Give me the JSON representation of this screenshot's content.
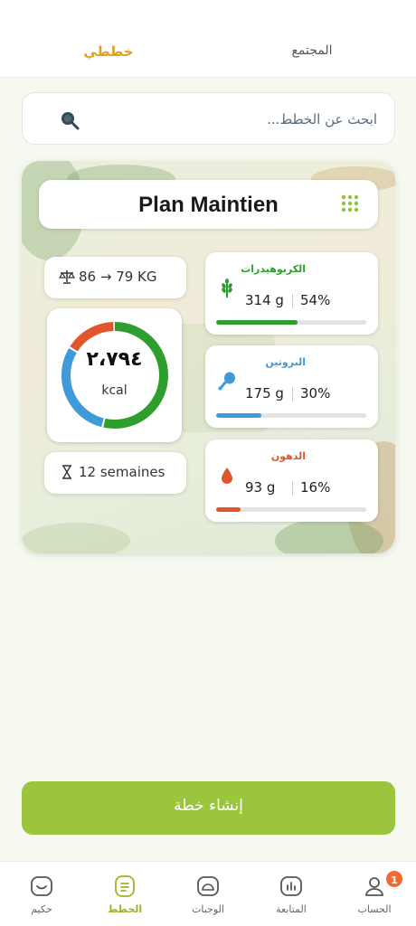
{
  "tabs": {
    "active": "خططي",
    "inactive": "المجتمع"
  },
  "search": {
    "placeholder": "ابحث عن الخطط..."
  },
  "plan": {
    "title": "Plan Maintien",
    "weight": "86 → 79 KG",
    "duration": "12 semaines",
    "kcal_value": "٢،٧٩٤",
    "kcal_unit": "kcal",
    "macros": [
      {
        "name": "الكربوهيدرات",
        "grams": "314 g",
        "percent": "54%",
        "fraction": 0.54,
        "color": "#2e9e2e",
        "icon": "wheat-icon"
      },
      {
        "name": "البروتين",
        "grams": "175 g",
        "percent": "30%",
        "fraction": 0.3,
        "color": "#3f9ad9",
        "icon": "drumstick-icon"
      },
      {
        "name": "الدهون",
        "grams": "93 g",
        "percent": "16%",
        "fraction": 0.16,
        "color": "#e0552c",
        "icon": "drop-icon"
      }
    ]
  },
  "create_button": {
    "label": "إنشاء خطة"
  },
  "nav": {
    "items": [
      {
        "label": "حكيم",
        "icon": "chat-icon"
      },
      {
        "label": "الخطط",
        "icon": "plans-icon"
      },
      {
        "label": "الوجبات",
        "icon": "meals-icon"
      },
      {
        "label": "المتابعة",
        "icon": "tracking-icon"
      },
      {
        "label": "الحساب",
        "icon": "profile-icon"
      }
    ],
    "badge": "1"
  },
  "colors": {
    "accent": "#9bc53d",
    "active_tab": "#e0a21a",
    "carbs": "#2e9e2e",
    "protein": "#3f9ad9",
    "fat": "#e0552c"
  }
}
